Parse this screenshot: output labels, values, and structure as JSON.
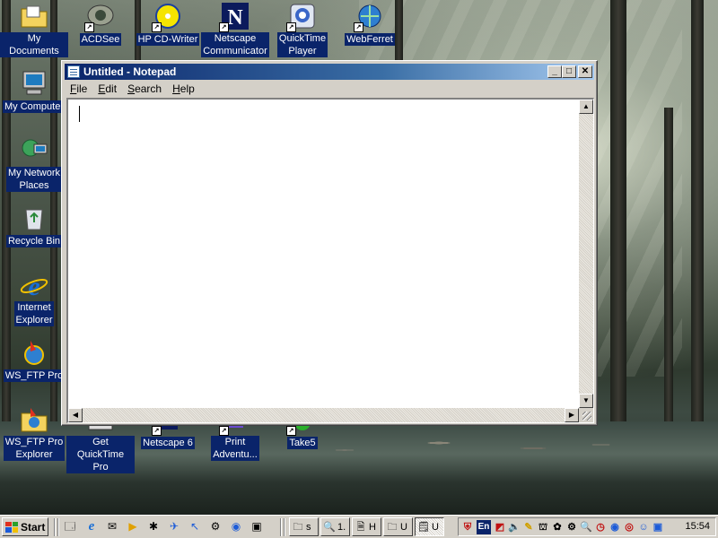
{
  "desktop": {
    "icons": [
      {
        "label": "My Documents",
        "icon": "folder-documents-icon"
      },
      {
        "label": "ACDSee",
        "icon": "acdsee-icon"
      },
      {
        "label": "HP CD-Writer",
        "icon": "cd-writer-icon"
      },
      {
        "label": "Netscape\nCommunicator",
        "icon": "netscape-icon"
      },
      {
        "label": "QuickTime\nPlayer",
        "icon": "quicktime-icon"
      },
      {
        "label": "WebFerret",
        "icon": "webferret-icon"
      },
      {
        "label": "My Computer",
        "icon": "computer-icon"
      },
      {
        "label": "My Network\nPlaces",
        "icon": "network-icon"
      },
      {
        "label": "Recycle Bin",
        "icon": "recycle-bin-icon"
      },
      {
        "label": "Internet\nExplorer",
        "icon": "internet-explorer-icon"
      },
      {
        "label": "WS_FTP Pro",
        "icon": "ws-ftp-icon"
      },
      {
        "label": "WS_FTP Pro\nExplorer",
        "icon": "ws-ftp-explorer-icon"
      },
      {
        "label": "Get QuickTime\nPro",
        "icon": "quicktime-pro-icon"
      },
      {
        "label": "Netscape 6",
        "icon": "netscape6-icon"
      },
      {
        "label": "Print\nAdventu...",
        "icon": "print-adventure-icon"
      },
      {
        "label": "Take5",
        "icon": "take5-icon"
      }
    ]
  },
  "notepad": {
    "title": "Untitled - Notepad",
    "menu": [
      {
        "label": "File",
        "accel": "F",
        "rest": "ile"
      },
      {
        "label": "Edit",
        "accel": "E",
        "rest": "dit"
      },
      {
        "label": "Search",
        "accel": "S",
        "rest": "earch"
      },
      {
        "label": "Help",
        "accel": "H",
        "rest": "elp"
      }
    ],
    "text": "",
    "controls": {
      "minimize": "_",
      "maximize": "□",
      "close": "✕"
    }
  },
  "taskbar": {
    "start_label": "Start",
    "quick_launch": [
      "show-desktop-icon",
      "internet-explorer-icon",
      "outlook-icon",
      "winamp-icon",
      "app-icon-1",
      "app-icon-2",
      "app-icon-3",
      "app-icon-4",
      "app-icon-5",
      "app-icon-6"
    ],
    "tasks": [
      {
        "label": "s",
        "icon": "explorer-icon"
      },
      {
        "label": "1.",
        "icon": "search-icon"
      },
      {
        "label": "H",
        "icon": "document-icon"
      },
      {
        "label": "U",
        "icon": "explorer-icon"
      },
      {
        "label": "U",
        "icon": "notepad-icon",
        "active": true
      }
    ],
    "tray": {
      "language": "En",
      "time": "15:54"
    }
  }
}
